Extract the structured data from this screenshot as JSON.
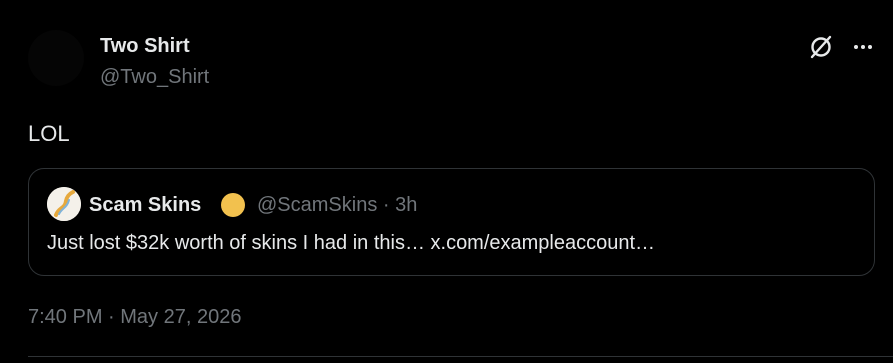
{
  "post": {
    "author_name": "Two Shirt",
    "author_handle": "@Two_Shirt",
    "text": "LOL",
    "timestamp": "7:40 PM · May 27, 2026"
  },
  "quoted_post": {
    "author_name": "Scam Skins",
    "author_handle": "@ScamSkins · 3h",
    "text": "Just lost $32k worth of skins I had in this… x.com/exampleaccount…",
    "badge_color": "#f2c14e"
  },
  "icons": {
    "grok": "grok-icon",
    "more": "more-options-icon"
  },
  "colors": {
    "background": "#000000",
    "text_primary": "#e7e9ea",
    "text_secondary": "#71767b",
    "border": "#2f3336"
  }
}
